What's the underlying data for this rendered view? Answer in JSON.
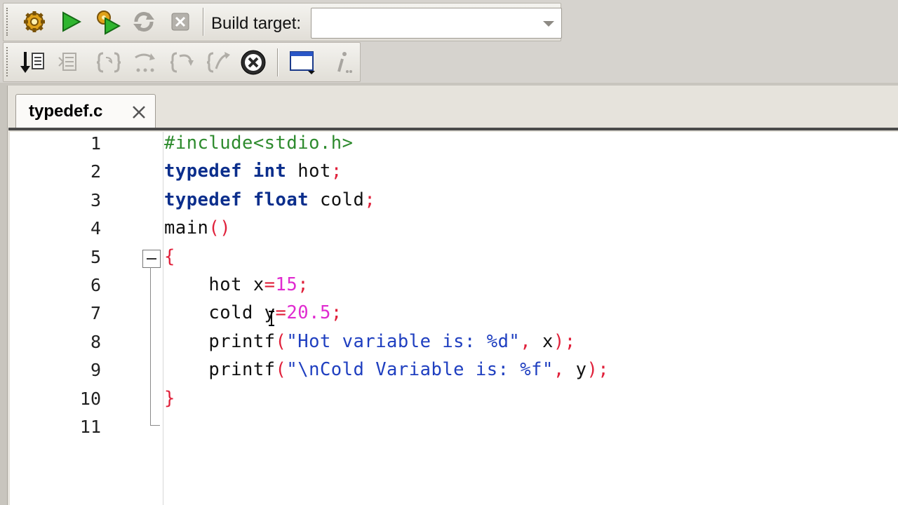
{
  "toolbar": {
    "build_target_label": "Build target:",
    "build_target_value": "",
    "buttons_row1": [
      {
        "name": "build-button",
        "icon": "gear-icon"
      },
      {
        "name": "run-button",
        "icon": "play-icon"
      },
      {
        "name": "build-and-run-button",
        "icon": "gear-play-icon"
      },
      {
        "name": "rebuild-button",
        "icon": "rebuild-icon"
      },
      {
        "name": "abort-button",
        "icon": "stop-icon"
      }
    ],
    "buttons_row2": [
      {
        "name": "debug-continue-button",
        "icon": "debug-arrow-icon"
      },
      {
        "name": "run-to-cursor-button",
        "icon": "run-to-cursor-icon"
      },
      {
        "name": "next-line-button",
        "icon": "next-line-icon"
      },
      {
        "name": "step-into-button",
        "icon": "step-into-icon"
      },
      {
        "name": "step-out-button",
        "icon": "step-out-icon"
      },
      {
        "name": "next-instruction-button",
        "icon": "next-instruction-icon"
      },
      {
        "name": "stop-debugger-button",
        "icon": "stop-circle-icon"
      },
      {
        "name": "debug-windows-button",
        "icon": "window-icon"
      },
      {
        "name": "info-button",
        "icon": "info-icon"
      }
    ]
  },
  "editor": {
    "tab_label": "typedef.c",
    "line_numbers": [
      "1",
      "2",
      "3",
      "4",
      "5",
      "6",
      "7",
      "8",
      "9",
      "10",
      "11"
    ],
    "lines": [
      [
        {
          "t": "#include<stdio.h>",
          "c": "pp"
        }
      ],
      [
        {
          "t": "typedef",
          "c": "kw"
        },
        {
          "t": " ",
          "c": "plain"
        },
        {
          "t": "int",
          "c": "kw"
        },
        {
          "t": " hot",
          "c": "plain"
        },
        {
          "t": ";",
          "c": "op"
        }
      ],
      [
        {
          "t": "typedef",
          "c": "kw"
        },
        {
          "t": " ",
          "c": "plain"
        },
        {
          "t": "float",
          "c": "kw"
        },
        {
          "t": " cold",
          "c": "plain"
        },
        {
          "t": ";",
          "c": "op"
        }
      ],
      [
        {
          "t": "main",
          "c": "plain"
        },
        {
          "t": "()",
          "c": "op"
        }
      ],
      [
        {
          "t": "{",
          "c": "op"
        }
      ],
      [
        {
          "t": "    hot x",
          "c": "plain"
        },
        {
          "t": "=",
          "c": "op"
        },
        {
          "t": "15",
          "c": "num"
        },
        {
          "t": ";",
          "c": "op"
        }
      ],
      [
        {
          "t": "    cold y",
          "c": "plain"
        },
        {
          "t": "=",
          "c": "op"
        },
        {
          "t": "20.5",
          "c": "num"
        },
        {
          "t": ";",
          "c": "op"
        }
      ],
      [
        {
          "t": "    printf",
          "c": "plain"
        },
        {
          "t": "(",
          "c": "op"
        },
        {
          "t": "\"Hot variable is: %d\"",
          "c": "str"
        },
        {
          "t": ",",
          "c": "op"
        },
        {
          "t": " x",
          "c": "plain"
        },
        {
          "t": ");",
          "c": "op"
        }
      ],
      [
        {
          "t": "    printf",
          "c": "plain"
        },
        {
          "t": "(",
          "c": "op"
        },
        {
          "t": "\"\\nCold Variable is: %f\"",
          "c": "str"
        },
        {
          "t": ",",
          "c": "op"
        },
        {
          "t": " y",
          "c": "plain"
        },
        {
          "t": ");",
          "c": "op"
        }
      ],
      [
        {
          "t": "}",
          "c": "op"
        }
      ],
      []
    ]
  }
}
